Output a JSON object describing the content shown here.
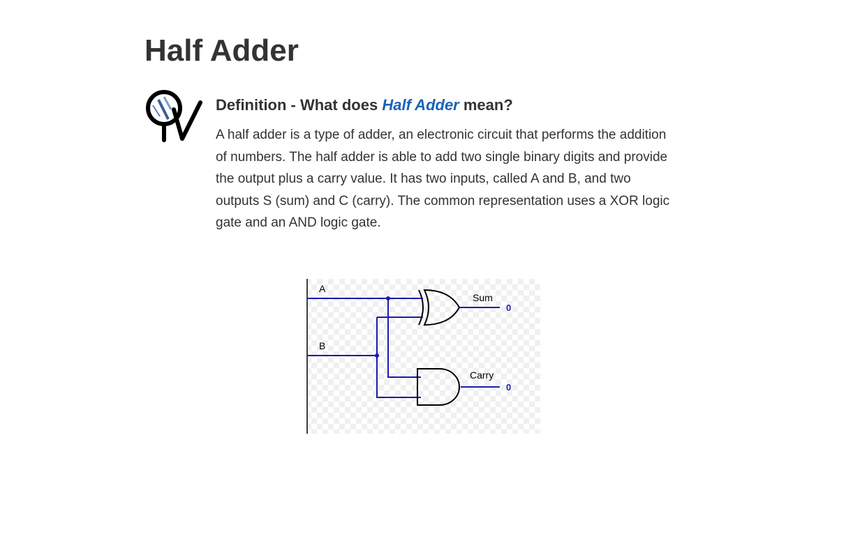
{
  "page": {
    "title": "Half Adder"
  },
  "definition": {
    "heading_prefix": "Definition - What does ",
    "heading_term": "Half Adder",
    "heading_suffix": " mean?",
    "body": "A half adder is a type of adder, an electronic circuit that performs the addition of numbers. The half adder is able to add two single binary digits and provide the output plus a carry value. It has two inputs, called A and B, and two outputs S (sum) and C (carry). The common representation uses a XOR logic gate and an AND logic gate."
  },
  "diagram": {
    "input_a": "A",
    "input_b": "B",
    "output_sum_label": "Sum",
    "output_carry_label": "Carry",
    "sum_value": "0",
    "carry_value": "0",
    "wire_color": "#1a1ab0"
  },
  "colors": {
    "text": "#333333",
    "accent": "#1a62b8"
  }
}
